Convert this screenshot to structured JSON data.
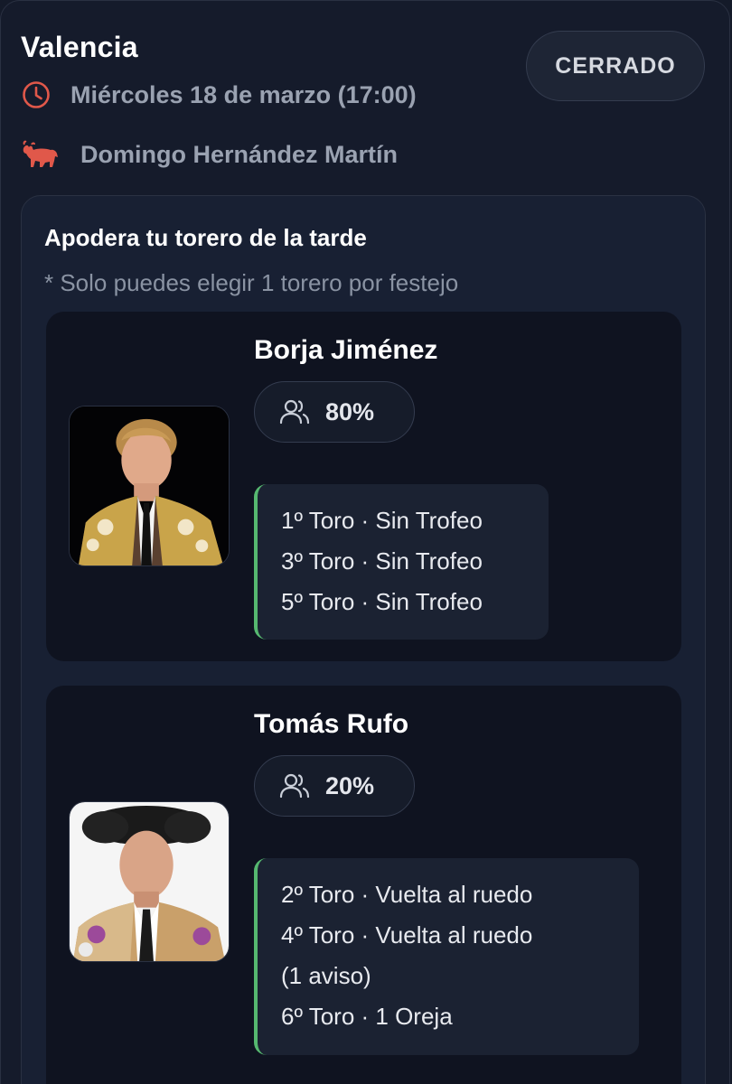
{
  "event": {
    "city": "Valencia",
    "status": "CERRADO",
    "date": "Miércoles 18 de marzo (17:00)",
    "rancher": "Domingo Hernández Martín",
    "icons": {
      "date": "clock-icon",
      "rancher": "bull-icon"
    },
    "accent_color": "#e0584a"
  },
  "section": {
    "title": "Apodera tu torero de la tarde",
    "note": "* Solo puedes elegir 1 torero por festejo"
  },
  "toreros": [
    {
      "name": "Borja Jiménez",
      "percent": "80%",
      "results": [
        "1º Toro · Sin Trofeo",
        "3º Toro · Sin Trofeo",
        "5º Toro · Sin Trofeo"
      ]
    },
    {
      "name": "Tomás Rufo",
      "percent": "20%",
      "results": [
        "2º Toro · Vuelta al ruedo",
        "4º Toro · Vuelta al ruedo",
        "(1 aviso)",
        "6º Toro · 1 Oreja"
      ]
    }
  ],
  "colors": {
    "result_border": "#56b870",
    "background": "#141a29"
  }
}
